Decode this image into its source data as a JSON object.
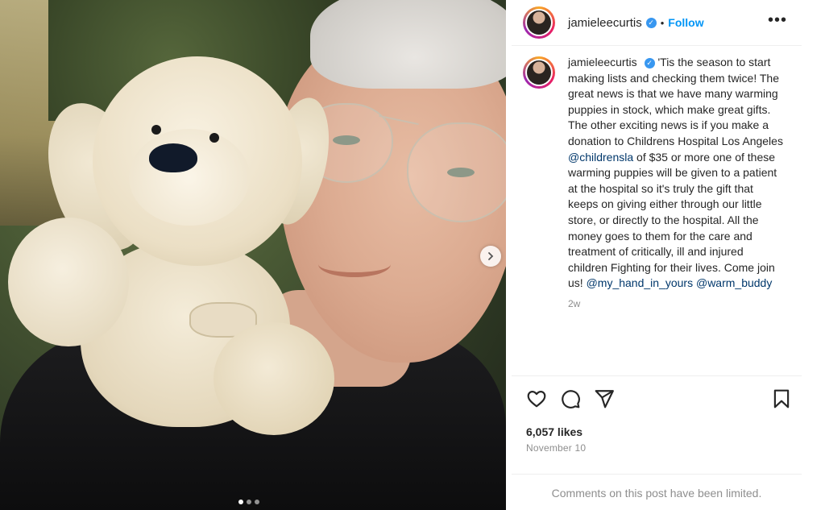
{
  "post": {
    "username": "jamieleecurtis",
    "verified_icon": "verified-badge-icon",
    "separator": "•",
    "follow_label": "Follow",
    "more_icon": "more-options-icon",
    "caption": {
      "username": "jamieleecurtis",
      "part1": "'Tis the season to start making lists and checking them twice! The great news is that we have many warming puppies in stock, which make great gifts. The other exciting news is if you make a donation to Childrens Hospital Los Angeles",
      "mention1": "@childrensla",
      "part2": "of $35 or more one of these warming puppies will be given to a patient at the hospital so it's truly the gift that keeps on giving either through our little store, or directly to the hospital. All the money goes to them for the care and treatment of critically, ill and injured children Fighting for their lives. Come join us!",
      "mention2": "@my_hand_in_yours",
      "mention3": "@warm_buddy",
      "age": "2w"
    },
    "likes": "6,057 likes",
    "date": "November 10",
    "comments_limited": "Comments on this post have been limited.",
    "carousel": {
      "total": 3,
      "active": 1
    }
  },
  "colors": {
    "link": "#0095f6",
    "mention": "#00376b",
    "muted": "#8e8e8e",
    "verified": "#3897f0"
  },
  "icons": [
    "like-heart-icon",
    "comment-icon",
    "share-icon",
    "bookmark-icon",
    "next-arrow-icon"
  ]
}
